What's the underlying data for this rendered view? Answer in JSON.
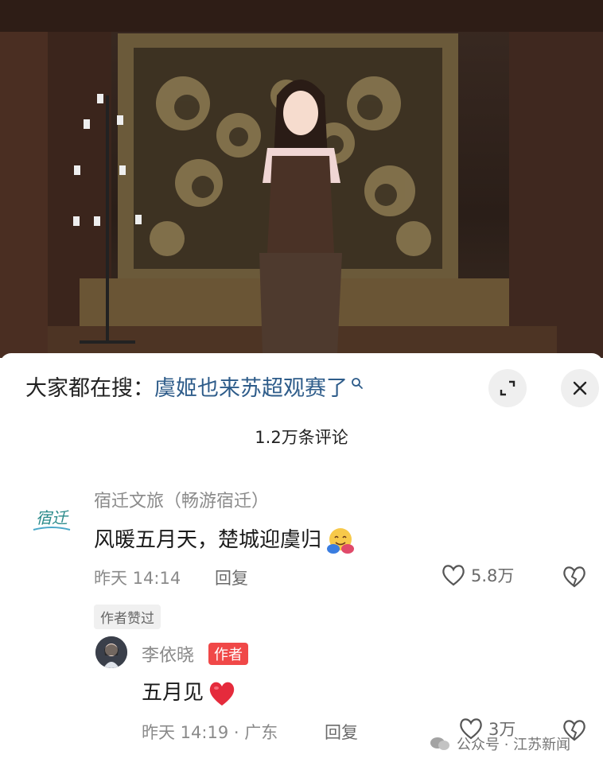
{
  "search": {
    "prefix": "大家都在搜：",
    "term": "虞姬也来苏超观赛了"
  },
  "comments_count": "1.2万条评论",
  "comments": [
    {
      "user": "宿迁文旅（畅游宿迁）",
      "avatar_text": "宿迁",
      "text": "风暖五月天，楚城迎虞归",
      "time": "昨天 14:14",
      "reply": "回复",
      "likes": "5.8万",
      "badge": "作者赞过"
    },
    {
      "user": "李依晓",
      "author_tag": "作者",
      "text": "五月见",
      "time": "昨天 14:19 · 广东",
      "reply": "回复",
      "likes": "3万"
    }
  ],
  "watermark": "公众号 · 江苏新闻",
  "icons": {
    "search": "search-icon",
    "expand": "expand-icon",
    "close": "close-icon",
    "like": "heart-outline-icon",
    "dislike": "broken-heart-icon",
    "hug_emoji": "hug-emoji",
    "red_heart": "red-heart-emoji"
  },
  "colors": {
    "search_term": "#2e5c8a",
    "author_badge": "#f04848"
  }
}
